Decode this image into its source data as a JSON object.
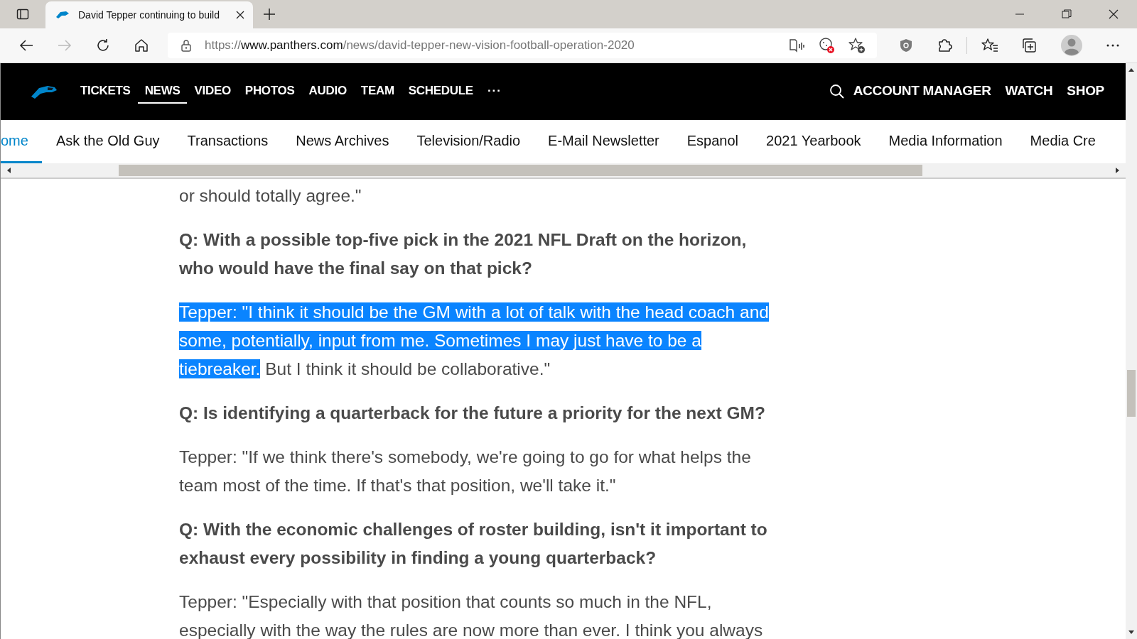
{
  "browser": {
    "tab": {
      "title": "David Tepper continuing to build"
    },
    "address": {
      "scheme": "https://",
      "host": "www.panthers.com",
      "path": "/news/david-tepper-new-vision-football-operation-2020"
    }
  },
  "site_nav": {
    "items": [
      {
        "label": "TICKETS",
        "selected": false
      },
      {
        "label": "NEWS",
        "selected": true
      },
      {
        "label": "VIDEO",
        "selected": false
      },
      {
        "label": "PHOTOS",
        "selected": false
      },
      {
        "label": "AUDIO",
        "selected": false
      },
      {
        "label": "TEAM",
        "selected": false
      },
      {
        "label": "SCHEDULE",
        "selected": false
      }
    ],
    "more": "···",
    "right_items": [
      "ACCOUNT MANAGER",
      "WATCH",
      "SHOP"
    ]
  },
  "sub_nav": {
    "items": [
      {
        "label": "ome",
        "selected": true
      },
      {
        "label": "Ask the Old Guy",
        "selected": false
      },
      {
        "label": "Transactions",
        "selected": false
      },
      {
        "label": "News Archives",
        "selected": false
      },
      {
        "label": "Television/Radio",
        "selected": false
      },
      {
        "label": "E-Mail Newsletter",
        "selected": false
      },
      {
        "label": "Espanol",
        "selected": false
      },
      {
        "label": "2021 Yearbook",
        "selected": false
      },
      {
        "label": "Media Information",
        "selected": false
      },
      {
        "label": "Media Cre",
        "selected": false
      }
    ]
  },
  "article": {
    "paragraphs": [
      {
        "kind": "answer",
        "text": "or should totally agree.\""
      },
      {
        "kind": "question",
        "text": "Q: With a possible top-five pick in the 2021 NFL Draft on the horizon, who would have the final say on that pick?"
      },
      {
        "kind": "answer",
        "selected_text": "Tepper: \"I think it should be the GM with a lot of talk with the head coach and some, potentially, input from me. Sometimes I may just have to be a tiebreaker.",
        "text": " But I think it should be collaborative.\""
      },
      {
        "kind": "question",
        "text": "Q: Is identifying a quarterback for the future a priority for the next GM?"
      },
      {
        "kind": "answer",
        "text": "Tepper: \"If we think there's somebody, we're going to go for what helps the team most of the time. If that's that position, we'll take it.\""
      },
      {
        "kind": "question",
        "text": "Q: With the economic challenges of roster building, isn't it important to exhaust every possibility in finding a young quarterback?"
      },
      {
        "kind": "answer",
        "text": "Tepper: \"Especially with that position that counts so much in the NFL, especially with the way the rules are now more than ever. I think you always"
      }
    ]
  }
}
